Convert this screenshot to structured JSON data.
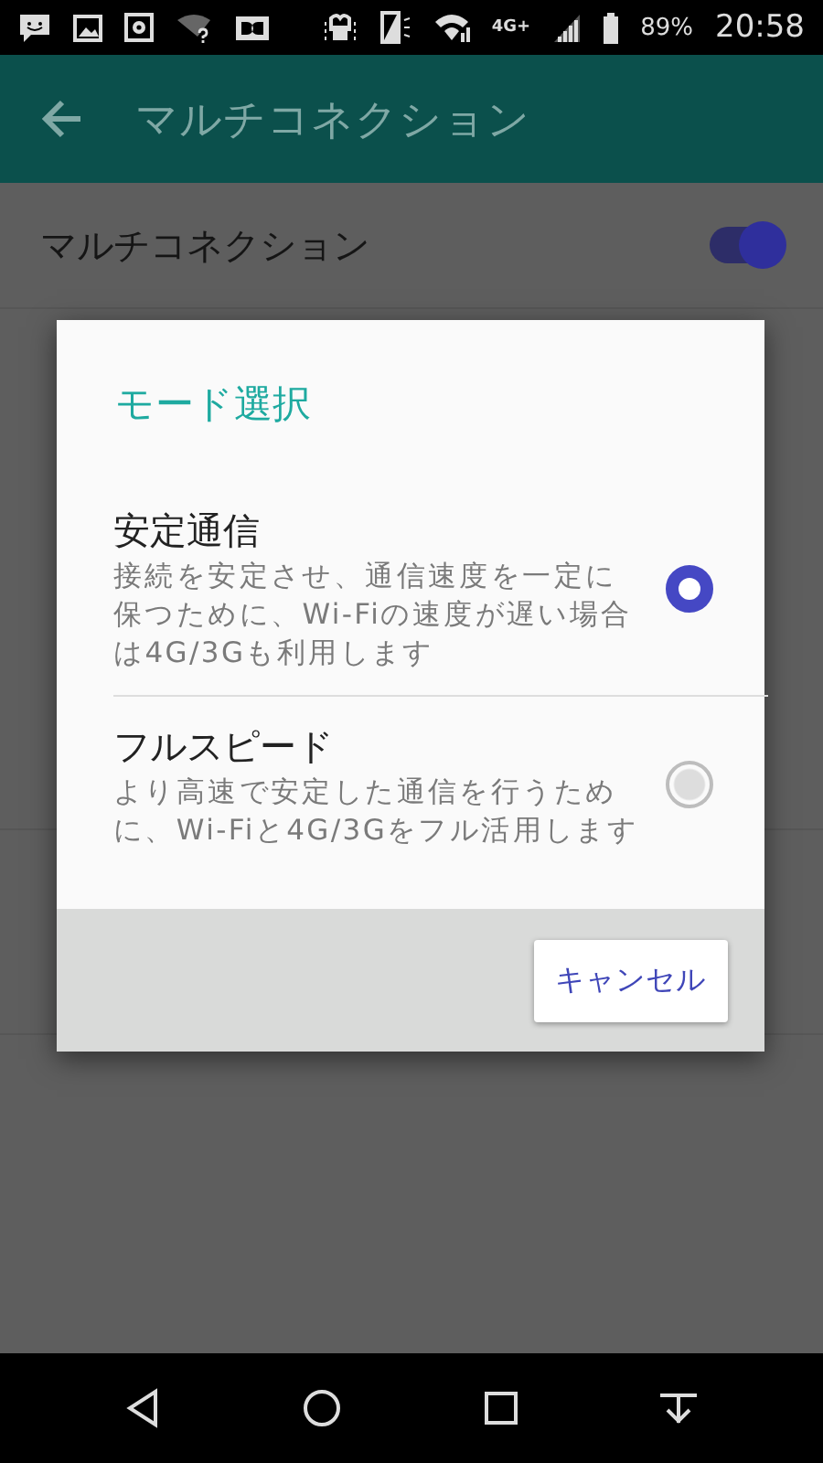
{
  "status_bar": {
    "network": "4G+",
    "battery": "89%",
    "time": "20:58"
  },
  "app_bar": {
    "title": "マルチコネクション"
  },
  "settings": {
    "toggle_row": {
      "title": "マルチコネクション",
      "on": true
    }
  },
  "dialog": {
    "title": "モード選択",
    "options": [
      {
        "title": "安定通信",
        "description": "接続を安定させ、通信速度を一定に保つために、Wi-Fiの速度が遅い場合は4G/3Gも利用します",
        "selected": true
      },
      {
        "title": "フルスピード",
        "description": "より高速で安定した通信を行うために、Wi-Fiと4G/3Gをフル活用します",
        "selected": false
      }
    ],
    "buttons": [
      "キャンセル"
    ]
  }
}
